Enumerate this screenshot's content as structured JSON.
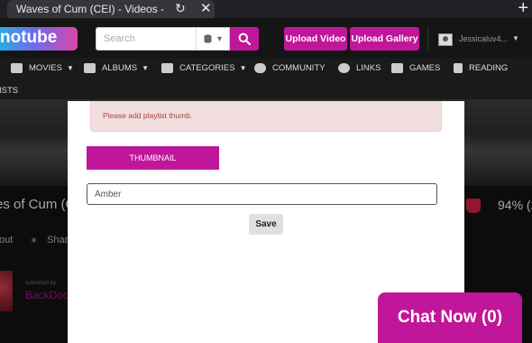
{
  "browser": {
    "tab_title": "Waves of Cum (CEI) - Videos -",
    "reload_icon": "reload-icon",
    "close_icon": "close-icon",
    "new_tab": "+"
  },
  "header": {
    "logo": "notube",
    "search_placeholder": "Search",
    "upload_video": "Upload Video",
    "upload_gallery": "Upload Gallery",
    "username": "Jessicaluv4...",
    "accent_color": "#c0169a"
  },
  "nav": {
    "items": [
      {
        "label": "MOVIES",
        "icon": "film-icon",
        "dropdown": true
      },
      {
        "label": "ALBUMS",
        "icon": "camera-icon",
        "dropdown": true
      },
      {
        "label": "CATEGORIES",
        "icon": "list-icon",
        "dropdown": true
      },
      {
        "label": "COMMUNITY",
        "icon": "users-icon",
        "dropdown": false
      },
      {
        "label": "LINKS",
        "icon": "chat-icon",
        "dropdown": false
      },
      {
        "label": "GAMES",
        "icon": "games-icon",
        "dropdown": false
      },
      {
        "label": "READING",
        "icon": "book-icon",
        "dropdown": false
      }
    ],
    "second_row": "ISTS"
  },
  "background_page": {
    "video_title": "es of Cum (Cl",
    "rating": "94% (2",
    "about": "out",
    "share": "Share",
    "submitted_by": "submitted by",
    "uploader": "BackDoo"
  },
  "modal": {
    "alert": "Please add playlist thumb.",
    "thumbnail_button": "THUMBNAIL",
    "name_value": "Amber",
    "save_button": "Save"
  },
  "chat": {
    "label": "Chat Now (0)"
  }
}
